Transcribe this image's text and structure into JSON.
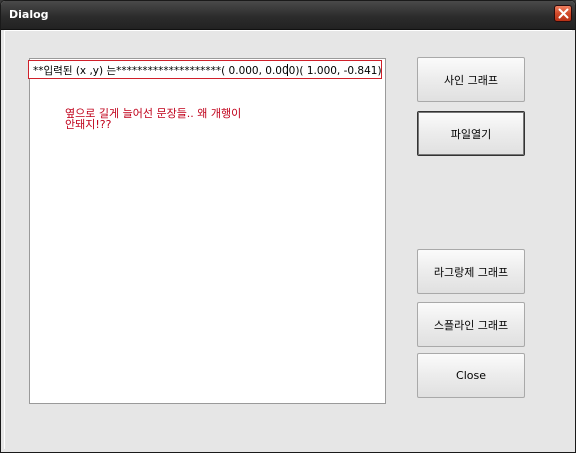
{
  "window": {
    "title": "Dialog"
  },
  "input": {
    "value": "**입력된 (x ,y) 는********************(  0.000,   0.000)(  1.000,  -0.841)"
  },
  "note": {
    "line1": "옆으로 길게 늘어선 문장들.. 왜 개행이",
    "line2": "안돼지!??"
  },
  "buttons": {
    "sine_graph": "사인 그래프",
    "open_file": "파일열기",
    "lagrange_graph": "라그랑제 그래프",
    "spline_graph": "스플라인 그래프",
    "close": "Close"
  },
  "colors": {
    "note_text": "#c0001a",
    "input_border": "#d0202a"
  }
}
